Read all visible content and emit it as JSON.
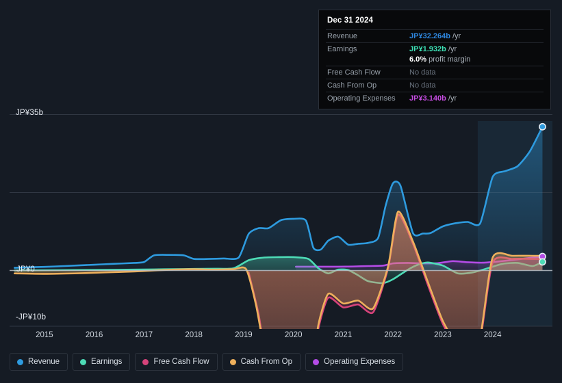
{
  "tooltip": {
    "date": "Dec 31 2024",
    "rows": [
      {
        "label": "Revenue",
        "value": "JP¥32.264b",
        "unit": "/yr",
        "style": "v-rev"
      },
      {
        "label": "Earnings",
        "value": "JP¥1.932b",
        "unit": "/yr",
        "style": "v-earn"
      },
      {
        "label": "",
        "value": "6.0%",
        "unit": "profit margin",
        "style": "v-margin"
      },
      {
        "label": "Free Cash Flow",
        "value": "No data",
        "unit": "",
        "style": "nodata"
      },
      {
        "label": "Cash From Op",
        "value": "No data",
        "unit": "",
        "style": "nodata"
      },
      {
        "label": "Operating Expenses",
        "value": "JP¥3.140b",
        "unit": "/yr",
        "style": "v-opex"
      }
    ]
  },
  "axes": {
    "y_top": "JP¥35b",
    "y_zero": "JP¥0",
    "y_neg": "-JP¥10b",
    "x_ticks": [
      "2015",
      "2016",
      "2017",
      "2018",
      "2019",
      "2020",
      "2021",
      "2022",
      "2023",
      "2024"
    ]
  },
  "legend": [
    {
      "label": "Revenue",
      "color": "#2e9bdf"
    },
    {
      "label": "Earnings",
      "color": "#4ddbb6"
    },
    {
      "label": "Free Cash Flow",
      "color": "#d6437a"
    },
    {
      "label": "Cash From Op",
      "color": "#eeb05c"
    },
    {
      "label": "Operating Expenses",
      "color": "#b44ce6"
    }
  ],
  "colors": {
    "background": "#151b24",
    "revenue": "#2e9bdf",
    "earnings": "#4ddbb6",
    "free_cash_flow": "#d6437a",
    "cash_from_op": "#eeb05c",
    "operating_expenses": "#b44ce6",
    "gridline": "#39414d",
    "zero_line": "#b9bfc7"
  },
  "chart_data": {
    "type": "area",
    "title": "",
    "xlabel": "",
    "ylabel": "JP¥ (billions)",
    "ylim": [
      -13,
      35
    ],
    "xlim": [
      2014.3,
      2025.2
    ],
    "grid": true,
    "legend_position": "bottom",
    "currency": "JP¥",
    "y_ticks": [
      35,
      17.5,
      0,
      -10
    ],
    "highlight_region": {
      "start": 2023.7,
      "end": 2025.2,
      "label": "forecast-band"
    },
    "series": [
      {
        "name": "Revenue",
        "color": "#2e9bdf",
        "x": [
          2014.4,
          2014.8,
          2015.2,
          2015.6,
          2016.0,
          2016.4,
          2016.8,
          2017.0,
          2017.2,
          2017.5,
          2017.8,
          2018.0,
          2018.3,
          2018.6,
          2018.9,
          2019.1,
          2019.3,
          2019.5,
          2019.75,
          2020.0,
          2020.25,
          2020.4,
          2020.55,
          2020.7,
          2020.9,
          2021.1,
          2021.3,
          2021.5,
          2021.7,
          2021.85,
          2022.0,
          2022.15,
          2022.4,
          2022.6,
          2022.75,
          2023.0,
          2023.25,
          2023.5,
          2023.75,
          2024.0,
          2024.25,
          2024.5,
          2024.75,
          2025.0
        ],
        "y": [
          0.6,
          0.75,
          0.9,
          1.1,
          1.3,
          1.5,
          1.7,
          1.9,
          3.4,
          3.5,
          3.4,
          2.6,
          2.6,
          2.7,
          2.9,
          8.2,
          9.5,
          9.5,
          11.3,
          11.6,
          11.2,
          5.1,
          4.7,
          6.7,
          7.6,
          5.8,
          6.0,
          6.2,
          7.3,
          14.5,
          19.6,
          19.0,
          8.4,
          8.3,
          8.4,
          9.9,
          10.6,
          10.9,
          10.6,
          21.0,
          22.3,
          23.4,
          26.8,
          32.264
        ]
      },
      {
        "name": "Earnings",
        "color": "#4ddbb6",
        "x": [
          2014.4,
          2015.0,
          2015.6,
          2016.2,
          2016.8,
          2017.2,
          2017.6,
          2018.0,
          2018.4,
          2018.8,
          2019.1,
          2019.4,
          2019.7,
          2020.0,
          2020.3,
          2020.5,
          2020.7,
          2020.9,
          2021.1,
          2021.3,
          2021.5,
          2021.8,
          2022.0,
          2022.3,
          2022.5,
          2022.7,
          2023.0,
          2023.3,
          2023.6,
          2023.9,
          2024.2,
          2024.5,
          2024.8,
          2025.0
        ],
        "y": [
          0.0,
          0.05,
          0.1,
          0.15,
          0.2,
          0.25,
          0.3,
          0.35,
          0.4,
          0.5,
          2.3,
          2.9,
          3.0,
          3.0,
          2.6,
          0.5,
          -0.3,
          0.2,
          0.1,
          -0.5,
          -1.1,
          -1.3,
          -0.9,
          0.2,
          1.3,
          1.8,
          1.1,
          -0.3,
          -0.2,
          0.5,
          1.5,
          1.7,
          1.0,
          1.932
        ]
      },
      {
        "name": "Free Cash Flow",
        "color": "#d6437a",
        "x": [
          2019.1,
          2019.3,
          2019.5,
          2019.8,
          2020.1,
          2020.35,
          2020.5,
          2020.7,
          2021.0,
          2021.3,
          2021.6,
          2021.9,
          2022.1,
          2022.4,
          2022.7,
          2023.0,
          2023.3,
          2023.55,
          2023.75,
          2024.0,
          2024.4,
          2024.8,
          2025.0
        ],
        "y": [
          -0.2,
          -4.5,
          -10.5,
          -11.9,
          -11.9,
          -11.3,
          -6.0,
          -2.8,
          -3.8,
          -3.5,
          -4.3,
          0.5,
          12.5,
          6.0,
          -1.5,
          -5.5,
          -8.0,
          -8.3,
          -7.2,
          1.8,
          2.6,
          2.6,
          2.6
        ]
      },
      {
        "name": "Cash From Op",
        "color": "#eeb05c",
        "x": [
          2014.4,
          2015.0,
          2015.6,
          2016.2,
          2016.8,
          2017.2,
          2017.6,
          2018.0,
          2018.4,
          2018.8,
          2019.05,
          2019.25,
          2019.5,
          2019.8,
          2020.1,
          2020.35,
          2020.5,
          2020.7,
          2021.0,
          2021.3,
          2021.6,
          2021.9,
          2022.1,
          2022.4,
          2022.7,
          2023.0,
          2023.3,
          2023.55,
          2023.75,
          2024.0,
          2024.4,
          2024.8,
          2025.0
        ],
        "y": [
          -0.3,
          -0.35,
          -0.3,
          -0.2,
          -0.1,
          0.0,
          0.2,
          0.3,
          0.2,
          0.3,
          0.3,
          -3.6,
          -10.2,
          -11.6,
          -11.6,
          -11.0,
          -5.6,
          -2.4,
          -3.4,
          -3.1,
          -3.9,
          0.9,
          13.2,
          6.5,
          -1.2,
          -5.2,
          -7.7,
          -8.0,
          -6.9,
          2.9,
          3.3,
          3.3,
          3.3
        ]
      },
      {
        "name": "Operating Expenses",
        "color": "#b44ce6",
        "x": [
          2020.05,
          2020.3,
          2020.6,
          2020.9,
          2021.2,
          2021.5,
          2021.8,
          2022.0,
          2022.3,
          2022.6,
          2022.9,
          2023.2,
          2023.5,
          2023.8,
          2024.1,
          2024.5,
          2024.8,
          2025.0
        ],
        "y": [
          0.85,
          0.85,
          0.85,
          0.85,
          0.9,
          1.0,
          1.1,
          1.6,
          1.7,
          1.6,
          1.65,
          2.1,
          1.85,
          1.75,
          2.0,
          2.5,
          2.9,
          3.14
        ]
      }
    ]
  }
}
